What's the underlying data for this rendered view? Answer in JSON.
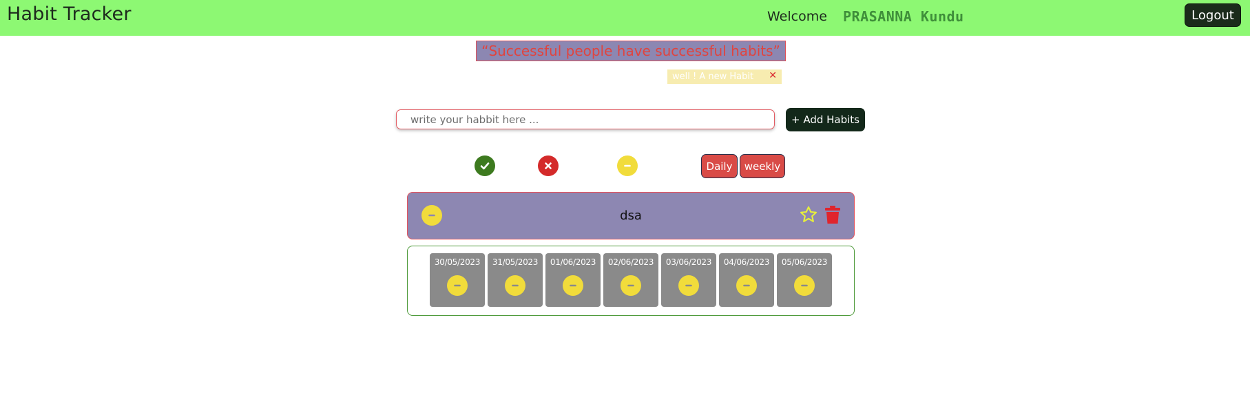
{
  "header": {
    "brand": "Habit Tracker",
    "welcome": "Welcome",
    "username": "PRASANNA Kundu",
    "logout_label": "Logout"
  },
  "quote": "“Successful people have successful habits”",
  "toast": {
    "message": "well ! A new Habit",
    "close_icon": "close-icon"
  },
  "add_habit": {
    "placeholder": "write your habbit here ...",
    "value": "",
    "button_label": "+ Add Habits"
  },
  "filters": {
    "status_icons": [
      "check-icon",
      "cross-icon",
      "minus-icon"
    ],
    "view_buttons": [
      "Daily",
      "weekly"
    ]
  },
  "habits": [
    {
      "name": "dsa",
      "status_icon": "minus-icon",
      "favorite_icon": "star-icon",
      "delete_icon": "trash-icon",
      "days": [
        {
          "date": "30/05/2023",
          "status": "minus-icon"
        },
        {
          "date": "31/05/2023",
          "status": "minus-icon"
        },
        {
          "date": "01/06/2023",
          "status": "minus-icon"
        },
        {
          "date": "02/06/2023",
          "status": "minus-icon"
        },
        {
          "date": "03/06/2023",
          "status": "minus-icon"
        },
        {
          "date": "04/06/2023",
          "status": "minus-icon"
        },
        {
          "date": "05/06/2023",
          "status": "minus-icon"
        }
      ]
    }
  ],
  "colors": {
    "header_bg": "#8df873",
    "quote_bg": "#8c87b2",
    "quote_text": "#e0443f",
    "done": "#3d7a1f",
    "not_done": "#d42a2a",
    "pending": "#f1dc3b",
    "view_button": "#d94b47",
    "day_card": "#8a8a8a"
  }
}
